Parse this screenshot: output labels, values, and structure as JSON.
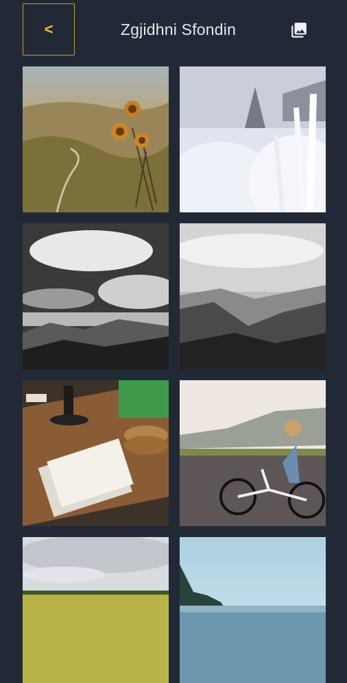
{
  "header": {
    "back_label": "<",
    "title": "Zgjidhni Sfondin",
    "gallery_icon": "image-gallery-icon"
  },
  "colors": {
    "background": "#222936",
    "accent": "#f2c12e",
    "title_text": "#e6e8ec"
  },
  "wallpapers": [
    {
      "name": "dry-flowers-valley"
    },
    {
      "name": "frosted-plants-cabin"
    },
    {
      "name": "black-white-clouds-mountains"
    },
    {
      "name": "black-white-forest-hills"
    },
    {
      "name": "desk-notebook-coasters"
    },
    {
      "name": "girl-riding-bicycle"
    },
    {
      "name": "green-field-sky"
    },
    {
      "name": "lake-trees-sky"
    }
  ]
}
